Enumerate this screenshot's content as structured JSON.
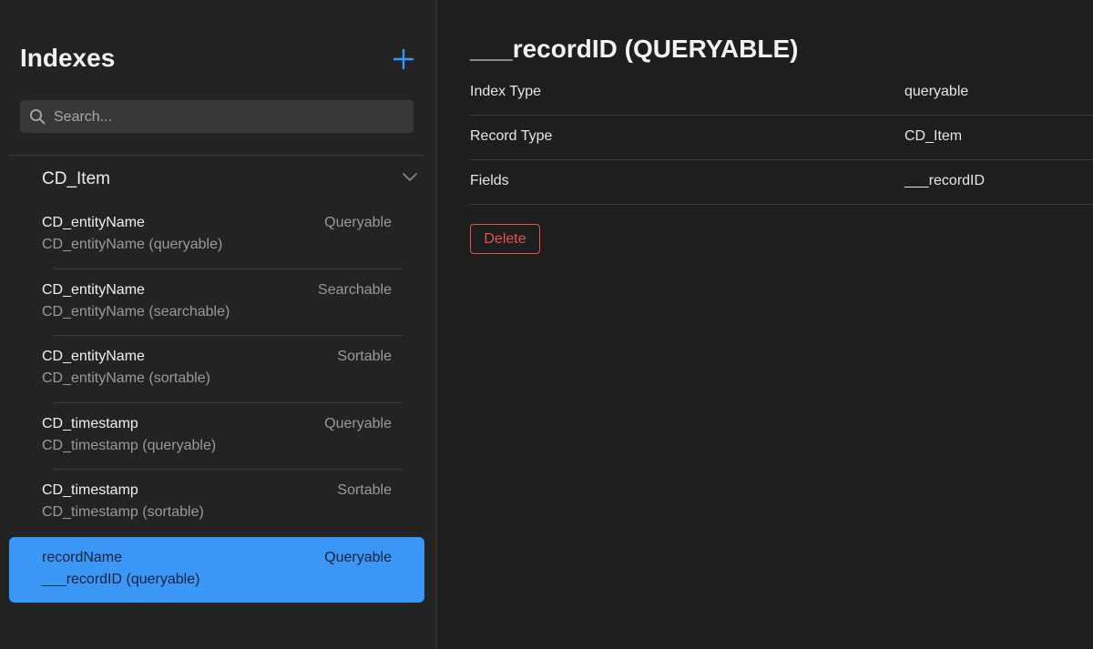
{
  "sidebar": {
    "title": "Indexes",
    "search_placeholder": "Search...",
    "group": {
      "label": "CD_Item"
    },
    "items": [
      {
        "name": "CD_entityName",
        "kind": "Queryable",
        "sub": "CD_entityName (queryable)"
      },
      {
        "name": "CD_entityName",
        "kind": "Searchable",
        "sub": "CD_entityName (searchable)"
      },
      {
        "name": "CD_entityName",
        "kind": "Sortable",
        "sub": "CD_entityName (sortable)"
      },
      {
        "name": "CD_timestamp",
        "kind": "Queryable",
        "sub": "CD_timestamp (queryable)"
      },
      {
        "name": "CD_timestamp",
        "kind": "Sortable",
        "sub": "CD_timestamp (sortable)"
      },
      {
        "name": "recordName",
        "kind": "Queryable",
        "sub": "___recordID (queryable)"
      }
    ]
  },
  "detail": {
    "title": "___recordID (QUERYABLE)",
    "rows": [
      {
        "key": "Index Type",
        "value": "queryable"
      },
      {
        "key": "Record Type",
        "value": "CD_Item"
      },
      {
        "key": "Fields",
        "value": "___recordID"
      }
    ],
    "delete_label": "Delete"
  },
  "colors": {
    "accent": "#3a97f6",
    "danger": "#e4534f",
    "background": "#1e1e1e",
    "sidebar": "#232323"
  }
}
